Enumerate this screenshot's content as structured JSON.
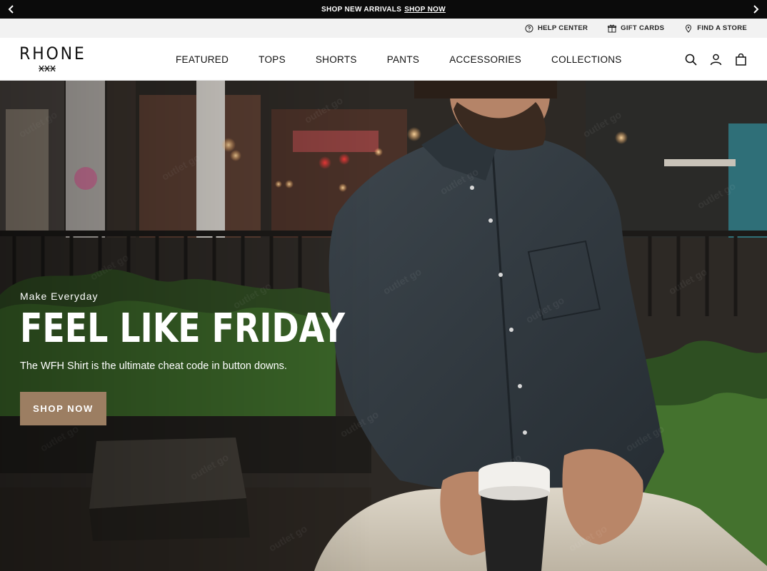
{
  "announcement": {
    "text": "SHOP NEW ARRIVALS",
    "link": "SHOP NOW",
    "prev_icon": "chevron-left-icon",
    "next_icon": "chevron-right-icon"
  },
  "utility": {
    "items": [
      {
        "label": "HELP CENTER",
        "icon": "help-circle-icon"
      },
      {
        "label": "GIFT CARDS",
        "icon": "gift-icon"
      },
      {
        "label": "FIND A STORE",
        "icon": "location-pin-icon"
      }
    ]
  },
  "header": {
    "logo": "RHONE",
    "nav": [
      "FEATURED",
      "TOPS",
      "SHORTS",
      "PANTS",
      "ACCESSORIES",
      "COLLECTIONS"
    ],
    "icons": [
      "search-icon",
      "account-icon",
      "bag-icon"
    ]
  },
  "hero": {
    "eyebrow": "Make Everyday",
    "headline": "FEEL LIKE FRIDAY",
    "subhead": "The WFH Shirt is the ultimate cheat code in button downs.",
    "cta": "SHOP NOW",
    "watermark": "outlet go"
  },
  "colors": {
    "announcement_bg": "#0b0b0b",
    "utility_bg": "#f2f2f2",
    "cta_bg": "#9c7e62",
    "text_dark": "#111111"
  }
}
